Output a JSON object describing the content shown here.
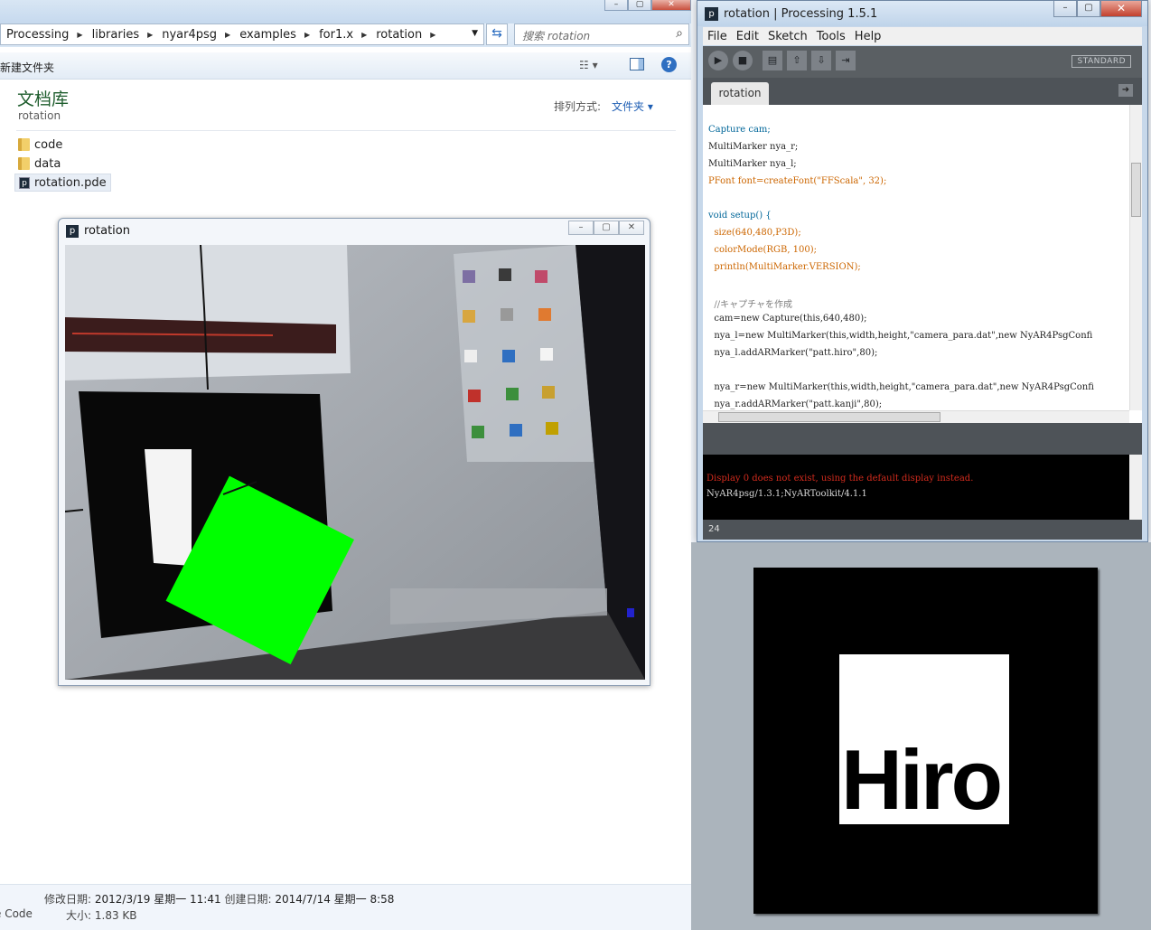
{
  "explorer": {
    "breadcrumb": [
      "Processing",
      "libraries",
      "nyar4psg",
      "examples",
      "for1.x",
      "rotation"
    ],
    "search_placeholder": "搜索 rotation",
    "toolbar": {
      "new_folder": "新建文件夹"
    },
    "library_title": "文档库",
    "library_subtitle": "rotation",
    "sort_label": "排列方式:",
    "sort_value": "文件夹 ▾",
    "files": [
      {
        "name": "code",
        "type": "folder"
      },
      {
        "name": "data",
        "type": "folder"
      },
      {
        "name": "rotation.pde",
        "type": "pde",
        "selected": true
      }
    ],
    "details": {
      "modified_label": "修改日期:",
      "modified_value": "2012/3/19 星期一 11:41",
      "created_label": "创建日期:",
      "created_value": "2014/7/14 星期一 8:58",
      "type_fragment": "e Code",
      "size_label": "大小:",
      "size_value": "1.83 KB"
    }
  },
  "sketch_window": {
    "title": "rotation",
    "rotation_deg": 27,
    "marker_fill": "#00ff00"
  },
  "ide": {
    "title": "rotation | Processing 1.5.1",
    "menu": [
      "File",
      "Edit",
      "Sketch",
      "Tools",
      "Help"
    ],
    "toolbar_icons": [
      "run-icon",
      "stop-icon",
      "new-icon",
      "open-icon",
      "save-icon",
      "export-icon"
    ],
    "mode": "STANDARD",
    "tab": "rotation",
    "code": [
      "Capture cam;",
      "MultiMarker nya_r;",
      "MultiMarker nya_l;",
      "PFont font=createFont(\"FFScala\", 32);",
      "",
      "void setup() {",
      "  size(640,480,P3D);",
      "  colorMode(RGB, 100);",
      "  println(MultiMarker.VERSION);",
      "",
      "  //キャプチャを作成",
      "  cam=new Capture(this,640,480);",
      "  nya_l=new MultiMarker(this,width,height,\"camera_para.dat\",new NyAR4PsgConfi",
      "  nya_l.addARMarker(\"patt.hiro\",80);",
      "",
      "  nya_r=new MultiMarker(this,width,height,\"camera_para.dat\",new NyAR4PsgConfi",
      "  nya_r.addARMarker(\"patt.kanji\",80);"
    ],
    "console": {
      "error": "Display 0 does not exist, using the default display instead.",
      "output": "NyAR4psg/1.3.1;NyARToolkit/4.1.1"
    },
    "status_line": "24"
  },
  "hiro_marker": {
    "text": "Hiro"
  }
}
